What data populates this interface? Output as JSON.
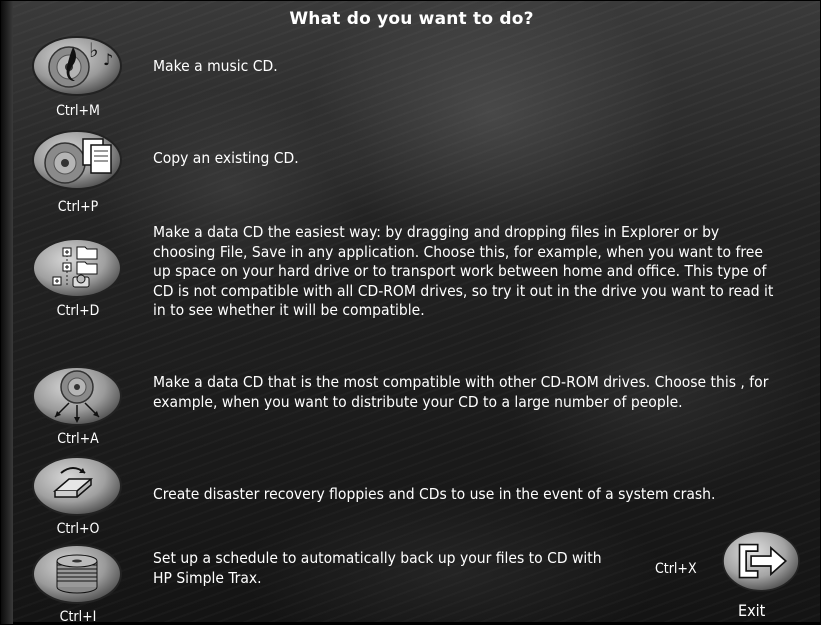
{
  "header": {
    "title": "What do you want to do?"
  },
  "options": [
    {
      "shortcut": "Ctrl+M",
      "description": "Make a music CD.",
      "icon": "music-cd-icon"
    },
    {
      "shortcut": "Ctrl+P",
      "description": "Copy an existing CD.",
      "icon": "copy-cd-icon"
    },
    {
      "shortcut": "Ctrl+D",
      "description": "Make a data CD the easiest way: by dragging and dropping files in Explorer or by choosing File, Save in any application. Choose this, for example, when you want to free up space on your hard drive or to transport work between home and office. This type of CD is not compatible with all CD-ROM drives, so try it out in the drive you want to read it in to see whether it will be compatible.",
      "icon": "data-cd-folders-icon"
    },
    {
      "shortcut": "Ctrl+A",
      "description": "Make a data CD that is the most compatible with other CD-ROM drives. Choose this , for example, when you want to distribute your CD to a large number of people.",
      "icon": "compatible-cd-icon"
    },
    {
      "shortcut": "Ctrl+O",
      "description": "Create disaster recovery floppies and CDs to use in the event of a system crash.",
      "icon": "disaster-recovery-icon"
    },
    {
      "shortcut": "Ctrl+I",
      "description": "Set up a schedule to automatically back up your files to CD with HP Simple Trax.",
      "icon": "backup-schedule-icon"
    }
  ],
  "exit": {
    "shortcut": "Ctrl+X",
    "label": "Exit",
    "icon": "exit-arrow-icon"
  },
  "colors": {
    "text": "#ffffff",
    "background": "#232323",
    "button": "#9a9a9a"
  }
}
